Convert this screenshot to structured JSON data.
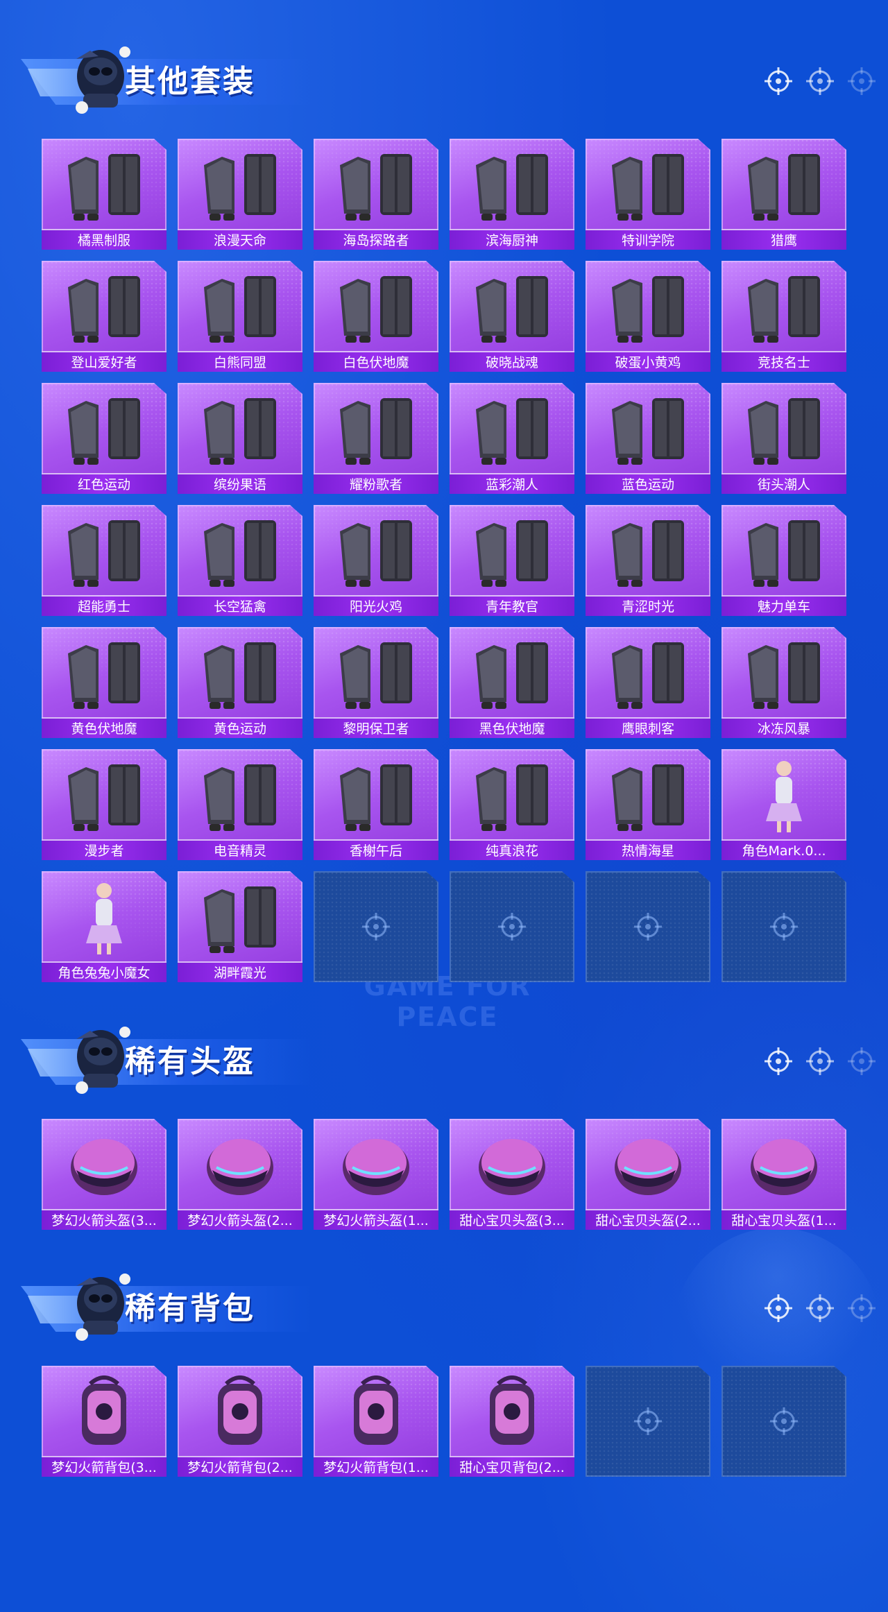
{
  "watermark": "GAME FOR PEACE",
  "colors": {
    "background": "#0d4fd6",
    "card": "#a855ef",
    "label_bar": "#7b1fd6",
    "empty_card": "#1d4a9c"
  },
  "sections": [
    {
      "title": "其他套装",
      "items": [
        {
          "label": "橘黑制服",
          "icon": "outfit-icon"
        },
        {
          "label": "浪漫天命",
          "icon": "outfit-icon"
        },
        {
          "label": "海岛探路者",
          "icon": "outfit-icon"
        },
        {
          "label": "滨海厨神",
          "icon": "outfit-icon"
        },
        {
          "label": "特训学院",
          "icon": "outfit-icon"
        },
        {
          "label": "猎鹰",
          "icon": "outfit-icon"
        },
        {
          "label": "登山爱好者",
          "icon": "outfit-icon"
        },
        {
          "label": "白熊同盟",
          "icon": "outfit-icon"
        },
        {
          "label": "白色伏地魔",
          "icon": "outfit-icon"
        },
        {
          "label": "破晓战魂",
          "icon": "outfit-icon"
        },
        {
          "label": "破蛋小黄鸡",
          "icon": "outfit-icon"
        },
        {
          "label": "竞技名士",
          "icon": "outfit-icon"
        },
        {
          "label": "红色运动",
          "icon": "outfit-icon"
        },
        {
          "label": "缤纷果语",
          "icon": "outfit-icon"
        },
        {
          "label": "耀粉歌者",
          "icon": "outfit-icon"
        },
        {
          "label": "蓝彩潮人",
          "icon": "outfit-icon"
        },
        {
          "label": "蓝色运动",
          "icon": "outfit-icon"
        },
        {
          "label": "街头潮人",
          "icon": "outfit-icon"
        },
        {
          "label": "超能勇士",
          "icon": "outfit-icon"
        },
        {
          "label": "长空猛禽",
          "icon": "outfit-icon"
        },
        {
          "label": "阳光火鸡",
          "icon": "outfit-icon"
        },
        {
          "label": "青年教官",
          "icon": "outfit-icon"
        },
        {
          "label": "青涩时光",
          "icon": "outfit-icon"
        },
        {
          "label": "魅力单车",
          "icon": "outfit-icon"
        },
        {
          "label": "黄色伏地魔",
          "icon": "outfit-icon"
        },
        {
          "label": "黄色运动",
          "icon": "outfit-icon"
        },
        {
          "label": "黎明保卫者",
          "icon": "outfit-icon"
        },
        {
          "label": "黑色伏地魔",
          "icon": "outfit-icon"
        },
        {
          "label": "鹰眼刺客",
          "icon": "outfit-icon"
        },
        {
          "label": "冰冻风暴",
          "icon": "outfit-icon"
        },
        {
          "label": "漫步者",
          "icon": "outfit-icon"
        },
        {
          "label": "电音精灵",
          "icon": "outfit-icon"
        },
        {
          "label": "香榭午后",
          "icon": "outfit-icon"
        },
        {
          "label": "纯真浪花",
          "icon": "outfit-icon"
        },
        {
          "label": "热情海星",
          "icon": "outfit-icon"
        },
        {
          "label": "角色Mark.0...",
          "icon": "character-icon"
        },
        {
          "label": "角色兔兔小魔女",
          "icon": "character-icon"
        },
        {
          "label": "湖畔霞光",
          "icon": "outfit-icon"
        }
      ],
      "empty_slots": 4
    },
    {
      "title": "稀有头盔",
      "items": [
        {
          "label": "梦幻火箭头盔(3...",
          "icon": "helmet-icon"
        },
        {
          "label": "梦幻火箭头盔(2...",
          "icon": "helmet-icon"
        },
        {
          "label": "梦幻火箭头盔(1...",
          "icon": "helmet-icon"
        },
        {
          "label": "甜心宝贝头盔(3...",
          "icon": "helmet-icon"
        },
        {
          "label": "甜心宝贝头盔(2...",
          "icon": "helmet-icon"
        },
        {
          "label": "甜心宝贝头盔(1...",
          "icon": "helmet-icon"
        }
      ],
      "empty_slots": 0
    },
    {
      "title": "稀有背包",
      "items": [
        {
          "label": "梦幻火箭背包(3...",
          "icon": "backpack-icon"
        },
        {
          "label": "梦幻火箭背包(2...",
          "icon": "backpack-icon"
        },
        {
          "label": "梦幻火箭背包(1...",
          "icon": "backpack-icon"
        },
        {
          "label": "甜心宝贝背包(2...",
          "icon": "backpack-icon"
        }
      ],
      "empty_slots": 2
    }
  ]
}
